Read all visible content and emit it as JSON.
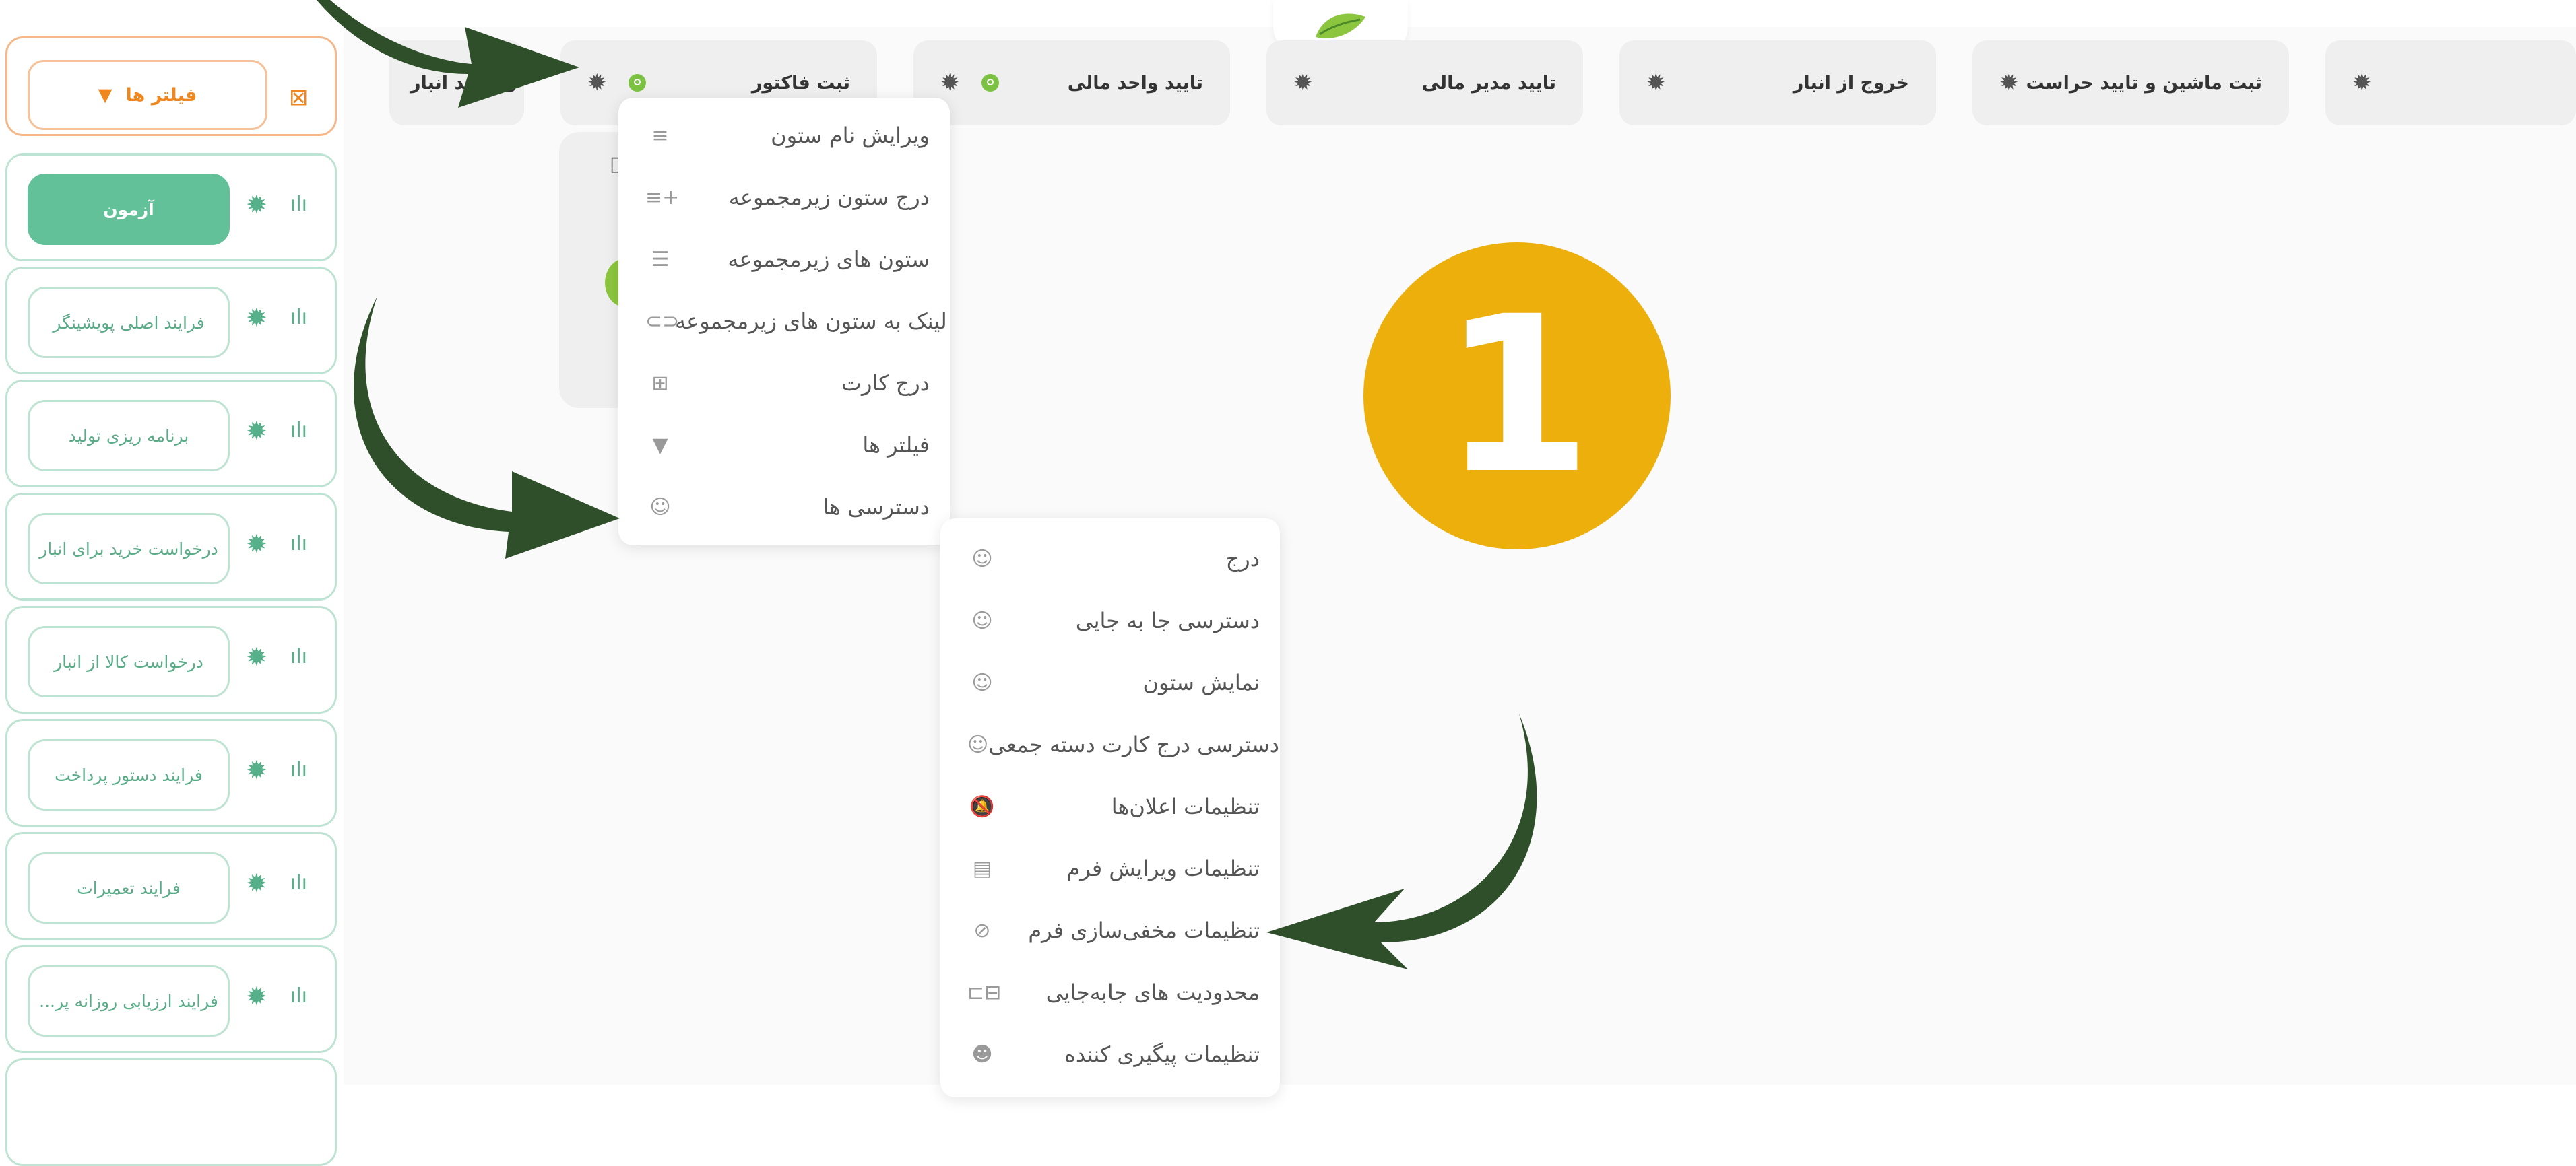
{
  "logo": {
    "icon": "leaf-logo-icon"
  },
  "columns": [
    {
      "title": "ثبت ماشین و تایید حراست"
    },
    {
      "title": "خروج از انبار"
    },
    {
      "title": "تایید مدیر مالی"
    },
    {
      "title": "تایید واحد مالی"
    },
    {
      "title": "ثبت فاکتور"
    },
    {
      "title": "ن واحد انبار"
    }
  ],
  "column_menu": {
    "items": [
      {
        "label": "ویرایش نام ستون",
        "icon": "edit-lines-icon"
      },
      {
        "label": "درج ستون زیرمجموعه",
        "icon": "list-add-icon"
      },
      {
        "label": "ستون های زیرمجموعه",
        "icon": "list-icon"
      },
      {
        "label": "لینک به ستون های زیرمجموعه",
        "icon": "link-icon"
      },
      {
        "label": "درج کارت",
        "icon": "plus-box-icon"
      },
      {
        "label": "فیلتر ها",
        "icon": "filter-icon"
      },
      {
        "label": "دسترسی ها",
        "icon": "user-gear-icon"
      }
    ]
  },
  "access_menu": {
    "items": [
      {
        "label": "درج",
        "icon": "user-gear-icon"
      },
      {
        "label": "دسترسی جا به جایی",
        "icon": "user-gear-icon"
      },
      {
        "label": "نمایش ستون",
        "icon": "user-gear-icon"
      },
      {
        "label": "دسترسی درج کارت دسته جمعی",
        "icon": "user-gear-icon"
      },
      {
        "label": "تنظیمات اعلان‌ها",
        "icon": "bell-off-icon"
      },
      {
        "label": "تنظیمات ویرایش فرم",
        "icon": "form-edit-icon"
      },
      {
        "label": "تنظیمات مخفی‌سازی فرم",
        "icon": "eye-off-icon"
      },
      {
        "label": "محدودیت های جابه‌جایی",
        "icon": "move-limit-icon"
      },
      {
        "label": "تنظیمات پیگیری کننده",
        "icon": "users-icon"
      }
    ]
  },
  "sidebar": {
    "filter_label": "فیلتر ها",
    "items": [
      {
        "label": "آزمون",
        "active": true
      },
      {
        "label": "فرایند اصلی پویشینگر",
        "active": false
      },
      {
        "label": "برنامه ریزی تولید",
        "active": false
      },
      {
        "label": "درخواست خرید برای انبار",
        "active": false
      },
      {
        "label": "درخواست کالا از انبار",
        "active": false
      },
      {
        "label": "فرایند دستور پرداخت",
        "active": false
      },
      {
        "label": "فرایند تعمیرات",
        "active": false
      },
      {
        "label": "فرایند ارزیابی روزانه پر...",
        "active": false
      }
    ]
  },
  "step_badge": {
    "number": "1",
    "color": "#ecaf0c"
  },
  "colors": {
    "accent_green": "#63c199",
    "filter_orange": "#f0861e",
    "arrow_green": "#2f4f2a"
  }
}
